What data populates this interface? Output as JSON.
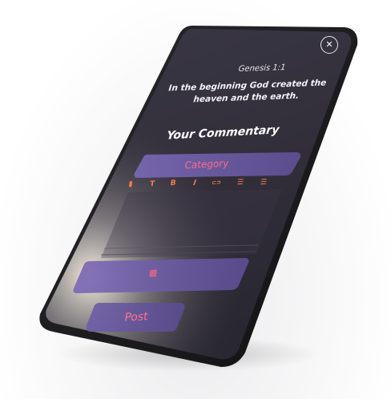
{
  "scripture": {
    "reference": "Genesis 1:1",
    "text": "In the beginning God created the heaven and the earth."
  },
  "commentary": {
    "title": "Your Commentary",
    "category_placeholder": "Category",
    "toolbar": [
      {
        "name": "bible-icon",
        "glyph": "▮"
      },
      {
        "name": "text-size-icon",
        "glyph": "T"
      },
      {
        "name": "bold-icon",
        "glyph": "B"
      },
      {
        "name": "italic-icon",
        "glyph": "I"
      },
      {
        "name": "link-icon",
        "glyph": "⊂⊃"
      },
      {
        "name": "bullet-list-icon",
        "glyph": "☰"
      },
      {
        "name": "numbered-list-icon",
        "glyph": "☰"
      }
    ],
    "attachment_icon": "calendar-icon",
    "post_label": "Post"
  },
  "colors": {
    "screen_top": "#35323f",
    "screen_bottom": "#2a2733",
    "panel_purple": "#6a5a9e",
    "accent_pink": "#ff6a8a",
    "accent_orange": "#ff7a4a"
  }
}
